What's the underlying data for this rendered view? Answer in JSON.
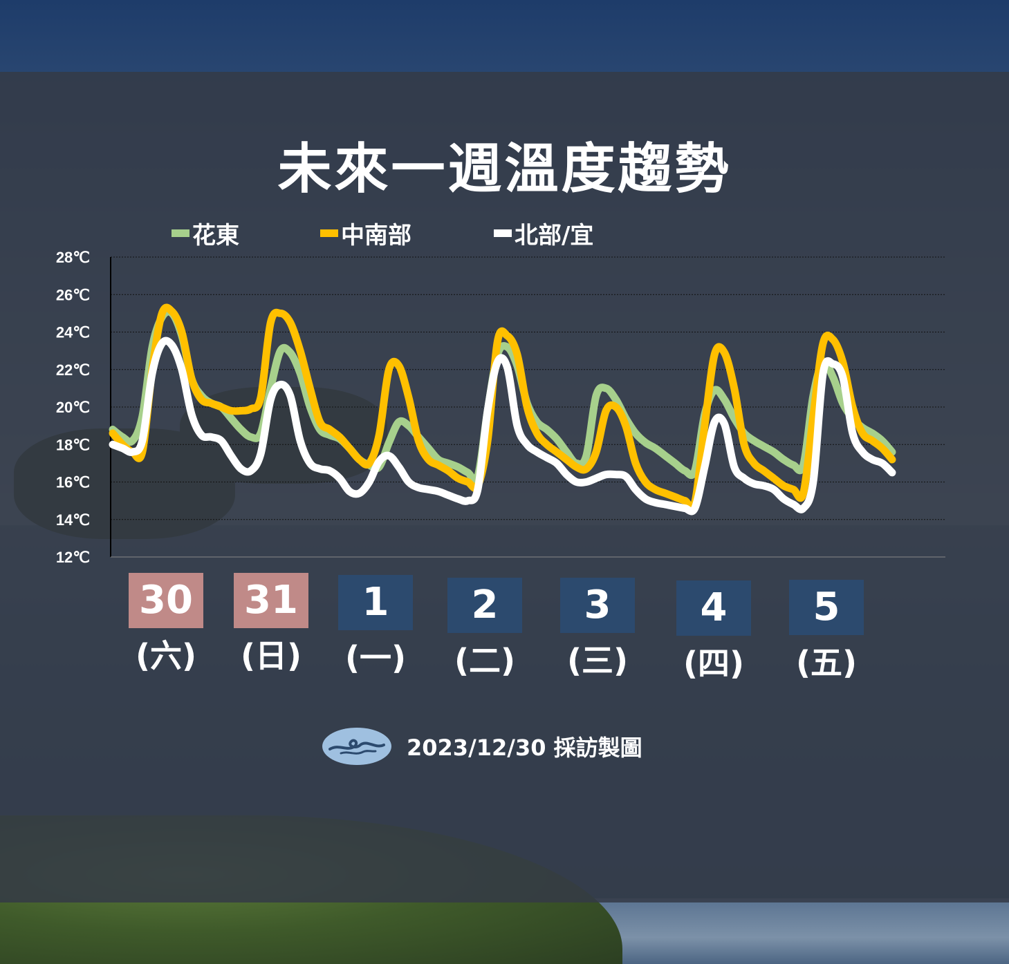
{
  "header": {
    "title": "未來一週溫度趨勢"
  },
  "colors": {
    "hualien": "#a7d08c",
    "central_south": "#ffc000",
    "north": "#ffffff",
    "weekend_badge": "#c08a88",
    "weekday_badge": "#2c4a6e",
    "grid": "#1a1a1a",
    "axis": "#000000"
  },
  "legend": [
    {
      "label": "花東",
      "series": "hualien"
    },
    {
      "label": "中南部",
      "series": "central_south"
    },
    {
      "label": "北部/宜",
      "series": "north"
    }
  ],
  "days": [
    {
      "num": "30",
      "weekday": "(六)",
      "weekend": true
    },
    {
      "num": "31",
      "weekday": "(日)",
      "weekend": true
    },
    {
      "num": "1",
      "weekday": "(一)",
      "weekend": false
    },
    {
      "num": "2",
      "weekday": "(二)",
      "weekend": false
    },
    {
      "num": "3",
      "weekday": "(三)",
      "weekend": false
    },
    {
      "num": "4",
      "weekday": "(四)",
      "weekend": false
    },
    {
      "num": "5",
      "weekday": "(五)",
      "weekend": false
    }
  ],
  "footer": {
    "text": "2023/12/30 採訪製圖",
    "logo": "cwa-cloud-logo"
  },
  "chart_data": {
    "type": "line",
    "title": "未來一週溫度趨勢",
    "xlabel": "",
    "ylabel": "",
    "ylim": [
      12,
      28
    ],
    "yticks": [
      12,
      14,
      16,
      18,
      20,
      22,
      24,
      26,
      28
    ],
    "ytick_labels": [
      "12℃",
      "14℃",
      "16℃",
      "18℃",
      "20℃",
      "22℃",
      "24℃",
      "26℃",
      "28℃"
    ],
    "grid": true,
    "legend_position": "top",
    "x_interval": "3-hourly",
    "series": [
      {
        "name": "花東",
        "key": "hualien",
        "values": [
          18.8,
          18.4,
          18.2,
          19.5,
          23.2,
          24.8,
          25.0,
          23.8,
          21.5,
          20.6,
          20.2,
          20.0,
          19.4,
          18.8,
          18.4,
          18.6,
          21.0,
          23.0,
          22.9,
          21.8,
          20.0,
          18.8,
          18.5,
          18.3,
          17.8,
          17.2,
          16.9,
          16.8,
          18.1,
          19.2,
          19.0,
          18.4,
          17.8,
          17.2,
          17.0,
          16.8,
          16.5,
          16.3,
          19.8,
          22.8,
          23.2,
          22.2,
          20.2,
          19.2,
          18.8,
          18.3,
          17.6,
          17.0,
          17.4,
          20.6,
          21.0,
          20.4,
          19.4,
          18.6,
          18.1,
          17.8,
          17.4,
          17.0,
          16.6,
          16.6,
          19.6,
          20.9,
          20.4,
          19.4,
          18.6,
          18.2,
          17.9,
          17.6,
          17.2,
          16.9,
          16.9,
          20.6,
          22.4,
          21.6,
          20.2,
          19.4,
          18.9,
          18.6,
          18.2,
          17.6
        ],
        "color": "#a7d08c"
      },
      {
        "name": "中南部",
        "key": "central_south",
        "values": [
          18.6,
          18.0,
          17.6,
          17.6,
          22.0,
          25.0,
          25.1,
          24.0,
          21.5,
          20.4,
          20.2,
          20.0,
          19.8,
          19.8,
          19.9,
          20.5,
          24.5,
          25.0,
          24.5,
          23.0,
          21.0,
          19.2,
          18.8,
          18.4,
          17.8,
          17.2,
          17.0,
          18.5,
          22.0,
          22.2,
          20.5,
          18.2,
          17.2,
          16.9,
          16.6,
          16.2,
          16.0,
          15.8,
          18.2,
          23.5,
          23.8,
          22.8,
          20.0,
          18.6,
          18.0,
          17.6,
          17.2,
          16.8,
          16.7,
          17.6,
          19.8,
          20.0,
          19.0,
          17.0,
          16.0,
          15.6,
          15.4,
          15.2,
          15.0,
          14.9,
          19.0,
          22.8,
          22.9,
          21.0,
          18.0,
          17.0,
          16.6,
          16.2,
          15.8,
          15.6,
          15.4,
          19.5,
          23.4,
          23.6,
          22.4,
          20.0,
          18.6,
          18.2,
          17.8,
          17.2
        ],
        "color": "#ffc000"
      },
      {
        "name": "北部/宜",
        "key": "north",
        "values": [
          18.0,
          17.8,
          17.6,
          18.2,
          21.8,
          23.4,
          23.3,
          22.0,
          19.6,
          18.5,
          18.4,
          18.2,
          17.4,
          16.7,
          16.6,
          17.5,
          20.4,
          21.2,
          20.6,
          18.2,
          17.0,
          16.7,
          16.6,
          16.2,
          15.5,
          15.4,
          16.0,
          17.1,
          17.4,
          16.8,
          16.0,
          15.7,
          15.6,
          15.5,
          15.3,
          15.1,
          15.0,
          15.6,
          19.8,
          22.4,
          22.1,
          19.0,
          18.0,
          17.6,
          17.3,
          17.0,
          16.4,
          16.0,
          16.0,
          16.2,
          16.4,
          16.4,
          16.3,
          15.6,
          15.1,
          14.9,
          14.8,
          14.7,
          14.6,
          14.6,
          16.8,
          19.2,
          19.1,
          16.8,
          16.2,
          15.9,
          15.8,
          15.6,
          15.1,
          14.8,
          14.6,
          16.0,
          21.8,
          22.3,
          21.6,
          18.6,
          17.6,
          17.2,
          17.0,
          16.5
        ],
        "color": "#ffffff"
      }
    ]
  }
}
